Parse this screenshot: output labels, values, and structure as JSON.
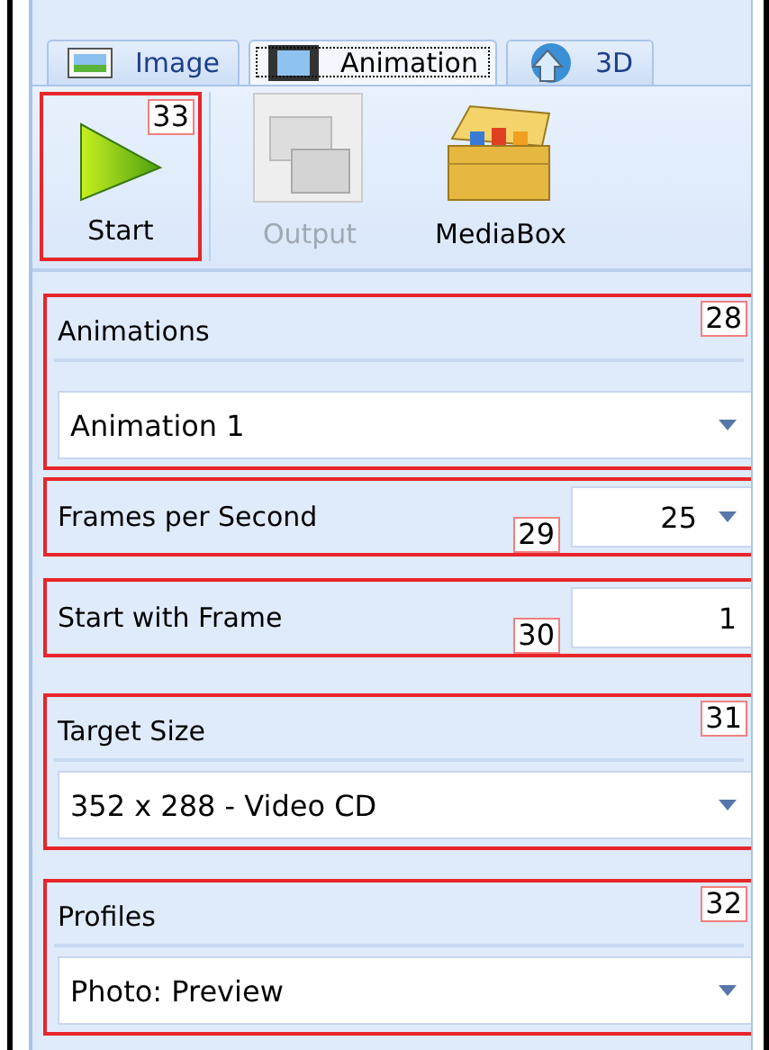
{
  "tabs": [
    {
      "label": "Image",
      "kind": "image",
      "selected": false
    },
    {
      "label": "Animation",
      "kind": "film",
      "selected": true
    },
    {
      "label": "3D",
      "kind": "globe",
      "selected": false
    }
  ],
  "toolbar": [
    {
      "label": "Start",
      "kind": "play",
      "disabled": false,
      "callout": "33"
    },
    {
      "label": "Output",
      "kind": "output",
      "disabled": true
    },
    {
      "label": "MediaBox",
      "kind": "box",
      "disabled": false
    }
  ],
  "settings": [
    {
      "kind": "dropdown",
      "label": "Animations",
      "value": "Animation 1",
      "callout": "28"
    },
    {
      "kind": "inline-dropdown",
      "label": "Frames per Second",
      "value": "25",
      "callout": "29"
    },
    {
      "kind": "inline-number",
      "label": "Start with Frame",
      "value": "1",
      "callout": "30"
    },
    {
      "kind": "dropdown",
      "label": "Target Size",
      "value": "352 x 288 - Video CD",
      "callout": "31"
    },
    {
      "kind": "dropdown",
      "label": "Profiles",
      "value": "Photo: Preview",
      "callout": "32"
    }
  ]
}
